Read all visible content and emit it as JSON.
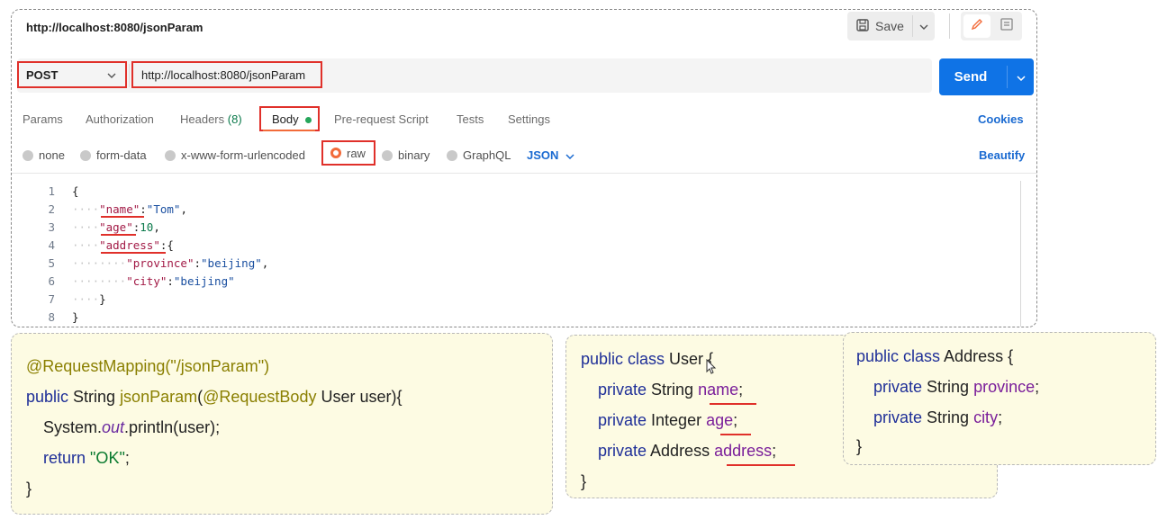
{
  "postman": {
    "title": "http://localhost:8080/jsonParam",
    "save_label": "Save",
    "method": "POST",
    "url": "http://localhost:8080/jsonParam",
    "send_label": "Send",
    "tabs": {
      "params": "Params",
      "authorization": "Authorization",
      "headers": "Headers",
      "headers_count": "(8)",
      "body": "Body",
      "prerequest": "Pre-request Script",
      "tests": "Tests",
      "settings": "Settings"
    },
    "cookies": "Cookies",
    "body_types": {
      "none": "none",
      "form_data": "form-data",
      "urlencoded": "x-www-form-urlencoded",
      "raw": "raw",
      "binary": "binary",
      "graphql": "GraphQL"
    },
    "format": "JSON",
    "beautify": "Beautify",
    "accent_color": "#f26b3a",
    "send_color": "#0f73e6",
    "highlight_color": "#e0302a",
    "editor": {
      "line_numbers": [
        "1",
        "2",
        "3",
        "4",
        "5",
        "6",
        "7",
        "8"
      ],
      "open_brace": "{",
      "name_key": "\"name\"",
      "name_value": "\"Tom\"",
      "age_key": "\"age\"",
      "age_value": "10",
      "address_key": "\"address\"",
      "province_key": "\"province\"",
      "province_value": "\"beijing\"",
      "city_key": "\"city\"",
      "city_value": "\"beijing\"",
      "close_inner": "}",
      "close_brace": "}"
    }
  },
  "controller_code": {
    "annotation": "@RequestMapping(\"/jsonParam\")",
    "sig_public": "public",
    "sig_type": " String ",
    "sig_method": "jsonParam",
    "sig_paren": "(",
    "sig_anno": "@RequestBody",
    "sig_rest": " User user){",
    "print_prefix": "System.",
    "print_out": "out",
    "print_suffix": ".println(user);",
    "return_kw": "return",
    "return_val": "\"OK\"",
    "return_end": ";",
    "close": "}"
  },
  "user_class": {
    "decl_kw": "public class",
    "decl_name": " User {",
    "f1_kw": "private",
    "f1_type": " String ",
    "f1_name": "name",
    "f2_kw": "private",
    "f2_type": " Integer ",
    "f2_name": "age",
    "f3_kw": "private",
    "f3_type": " Address ",
    "f3_name": "address",
    "semi": ";",
    "close": "}"
  },
  "address_class": {
    "decl_kw": "public class",
    "decl_name": " Address {",
    "f1_kw": "private",
    "f1_type": " String ",
    "f1_name": "province",
    "f2_kw": "private",
    "f2_type": " String ",
    "f2_name": "city",
    "semi": ";",
    "close": "}"
  }
}
